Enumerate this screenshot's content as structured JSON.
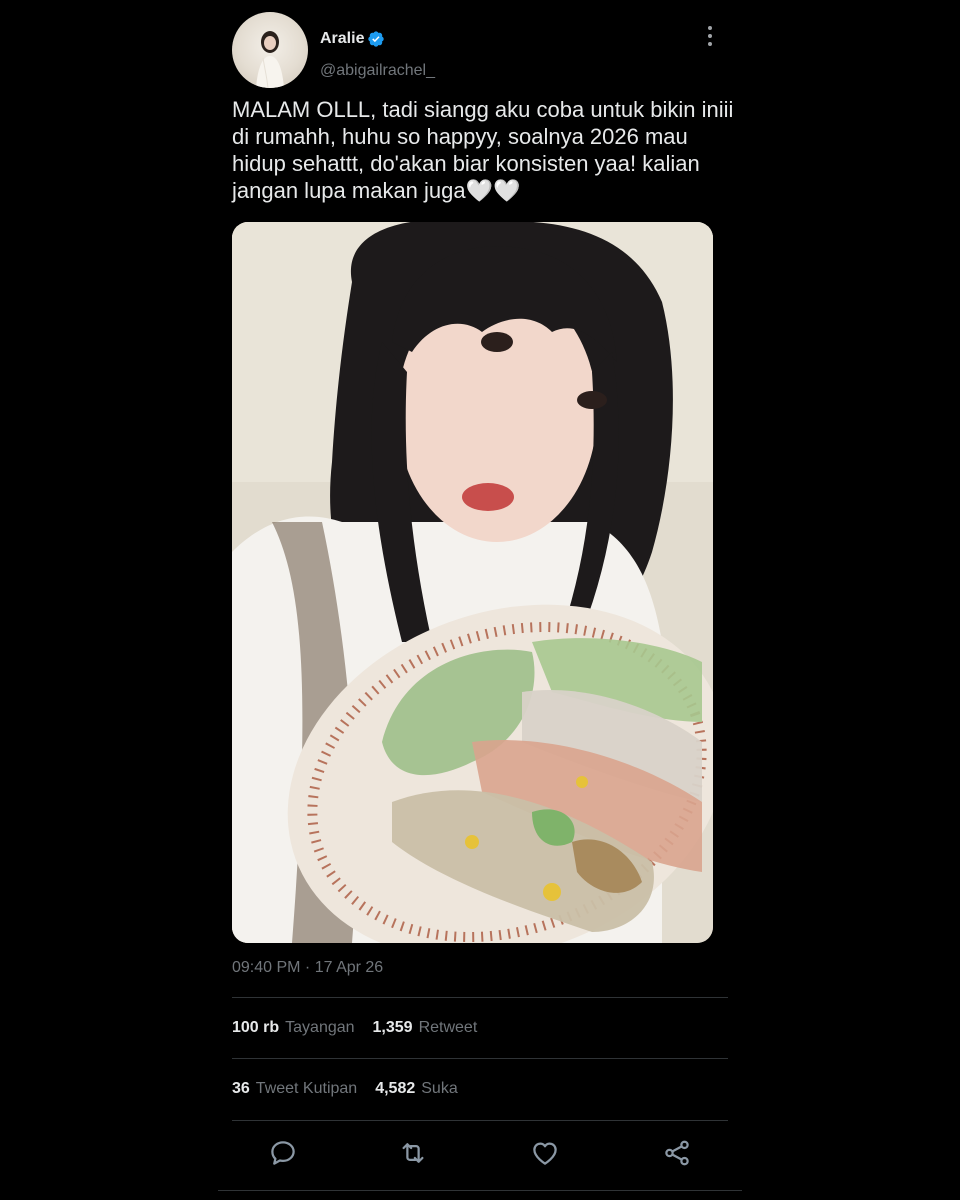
{
  "user": {
    "display_name": "Aralie",
    "handle": "@abigailrachel_",
    "verified_color": "#1d9bf0"
  },
  "tweet": {
    "text": "MALAM OLLL, tadi siangg aku coba untuk bikin iniii\ndi rumahh, huhu so happyy, soalnya 2026 mau\nhidup sehattt, do'akan biar konsisten yaa! kalian\njangan lupa makan juga🤍🤍",
    "timestamp": "09:40 PM · 17 Apr 26"
  },
  "stats": {
    "views": {
      "value": "100 rb",
      "label": "Tayangan"
    },
    "retweets": {
      "value": "1,359",
      "label": "Retweet"
    },
    "quotes": {
      "value": "36",
      "label": "Tweet Kutipan"
    },
    "likes": {
      "value": "4,582",
      "label": "Suka"
    }
  },
  "actions": {
    "reply_icon": "reply-icon",
    "retweet_icon": "retweet-icon",
    "like_icon": "heart-icon",
    "share_icon": "share-icon"
  },
  "colors": {
    "background": "#000000",
    "primary_text": "#e7e9ea",
    "secondary_text": "#71767b",
    "divider": "#2f3336"
  }
}
